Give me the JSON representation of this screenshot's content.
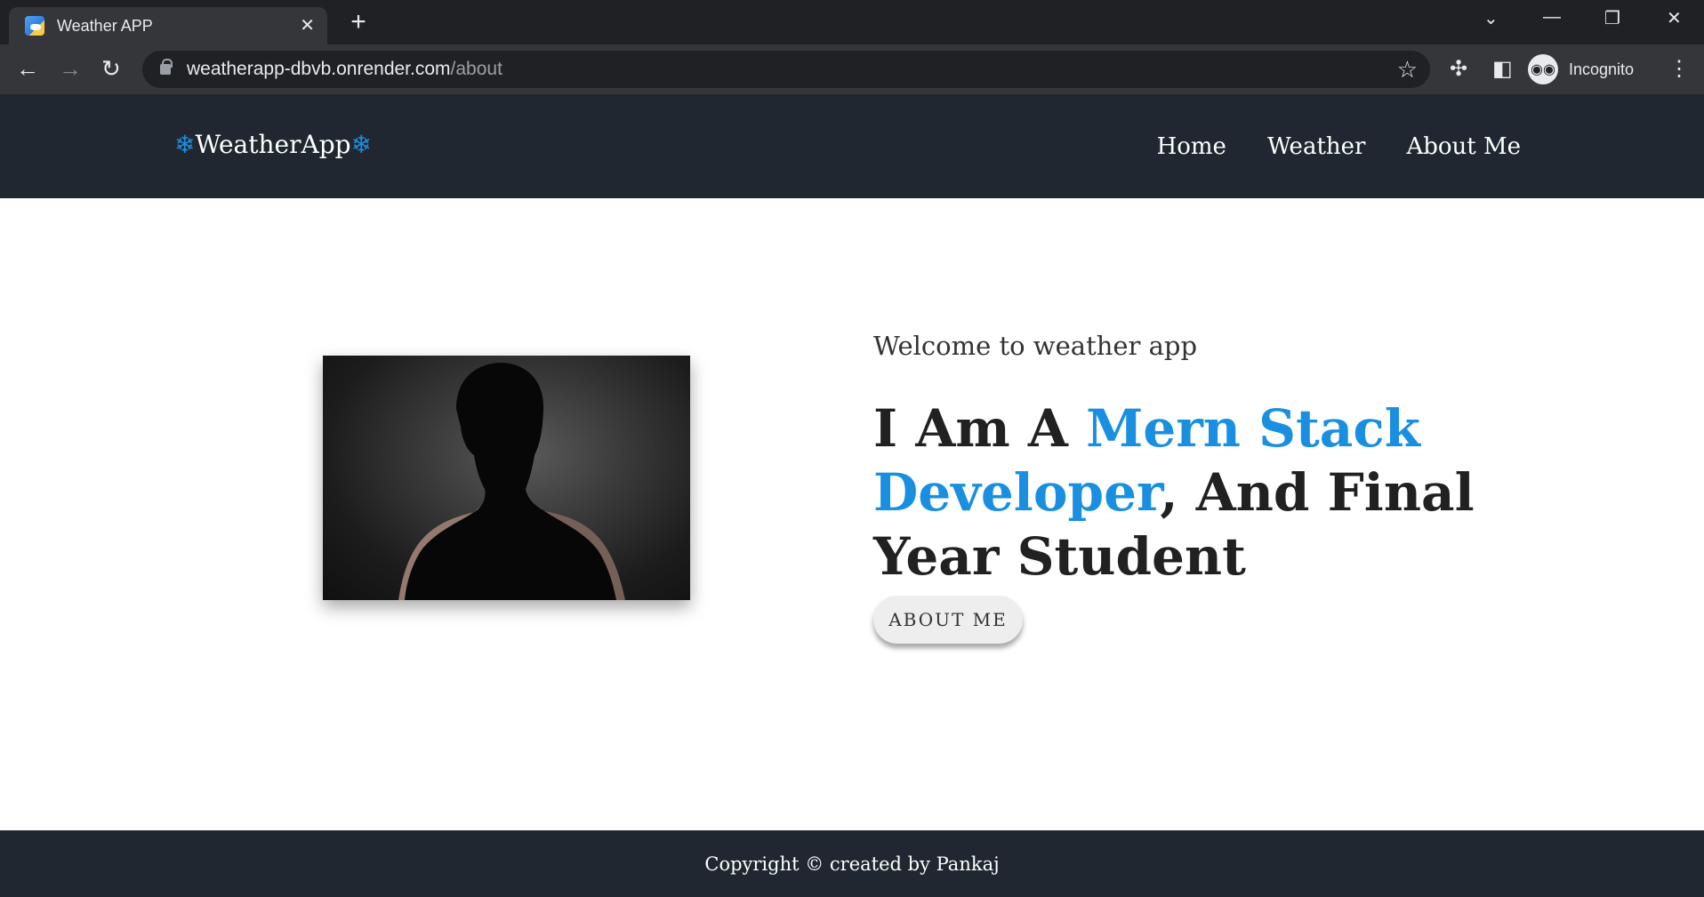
{
  "browser": {
    "tab_title": "Weather APP",
    "url_host": "weatherapp-dbvb.onrender.com",
    "url_path": "/about",
    "profile_label": "Incognito"
  },
  "site": {
    "brand": "WeatherApp",
    "brand_icon": "❄",
    "nav": [
      "Home",
      "Weather",
      "About Me"
    ],
    "welcome": "Welcome to weather app",
    "headline_pre": "I Am A ",
    "headline_accent": "Mern Stack Developer",
    "headline_post": ", And Final Year Student",
    "button_label": "ABOUT ME",
    "footer": "Copyright © created by Pankaj"
  },
  "colors": {
    "accent": "#1a8fe0",
    "navbar": "#212731",
    "tabbar": "#202124"
  }
}
